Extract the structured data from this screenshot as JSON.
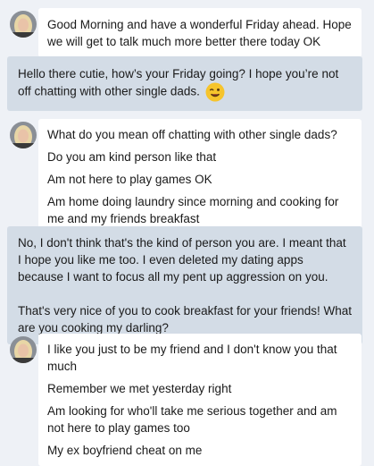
{
  "messages": [
    {
      "sender": "them",
      "lines": [
        "Good Morning and have a wonderful Friday ahead. Hope we will get to talk much more better there today OK"
      ]
    },
    {
      "sender": "me",
      "text": "Hello there cutie, how’s your Friday going? I hope you’re not off chatting with other single dads.",
      "emoji": "winking-face-emoji"
    },
    {
      "sender": "them",
      "lines": [
        "What do you mean off chatting with other single dads?",
        "Do you am kind person like that",
        "Am not here to play games OK",
        "Am home doing laundry since morning and cooking for me and my friends breakfast"
      ]
    },
    {
      "sender": "me",
      "paragraphs": [
        "No, I don't think that's the kind of person you are. I meant that I hope you like me too. I even deleted my dating apps because I want to focus all my pent up aggression on you.",
        "That's very nice of you to cook breakfast for your friends! What are you cooking my darling?"
      ]
    },
    {
      "sender": "them",
      "lines": [
        "I like you just to be my friend and I don't know you that much",
        "Remember we met yesterday right",
        "Am looking for who'll take me serious together and am not here to play games too",
        "My ex boyfriend cheat on me"
      ]
    }
  ]
}
